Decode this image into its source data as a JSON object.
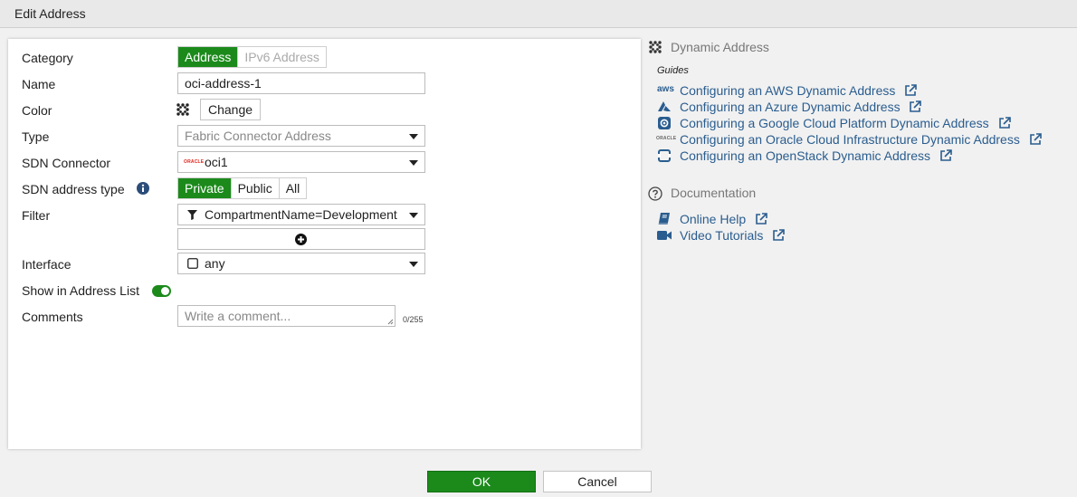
{
  "window": {
    "title": "Edit Address"
  },
  "form": {
    "category": {
      "label": "Category",
      "options": [
        "Address",
        "IPv6 Address"
      ],
      "selected": "Address"
    },
    "name": {
      "label": "Name",
      "value": "oci-address-1"
    },
    "color": {
      "label": "Color",
      "change_label": "Change"
    },
    "type": {
      "label": "Type",
      "value": "Fabric Connector Address"
    },
    "sdn_connector": {
      "label": "SDN Connector",
      "value": "oci1",
      "logo_text": "ORACLE"
    },
    "sdn_address_type": {
      "label": "SDN address type",
      "options": [
        "Private",
        "Public",
        "All"
      ],
      "selected": "Private"
    },
    "filter": {
      "label": "Filter",
      "value": "CompartmentName=Development"
    },
    "interface": {
      "label": "Interface",
      "value": "any"
    },
    "show_in_address_list": {
      "label": "Show in Address List",
      "enabled": true
    },
    "comments": {
      "label": "Comments",
      "placeholder": "Write a comment...",
      "counter": "0/255"
    }
  },
  "sidebar": {
    "dynamic_address": {
      "title": "Dynamic Address",
      "guides_label": "Guides",
      "links": [
        {
          "icon": "aws-icon",
          "label": "Configuring an AWS Dynamic Address"
        },
        {
          "icon": "azure-icon",
          "label": "Configuring an Azure Dynamic Address"
        },
        {
          "icon": "gcp-icon",
          "label": "Configuring a Google Cloud Platform Dynamic Address"
        },
        {
          "icon": "oracle-icon",
          "label": "Configuring an Oracle Cloud Infrastructure Dynamic Address"
        },
        {
          "icon": "openstack-icon",
          "label": "Configuring an OpenStack Dynamic Address"
        }
      ]
    },
    "documentation": {
      "title": "Documentation",
      "links": [
        {
          "icon": "book-icon",
          "label": "Online Help"
        },
        {
          "icon": "video-icon",
          "label": "Video Tutorials"
        }
      ]
    }
  },
  "footer": {
    "ok_label": "OK",
    "cancel_label": "Cancel"
  },
  "colors": {
    "accent": "#1b8a1b",
    "link": "#2a5d8f",
    "oracle": "#e2231a"
  },
  "aws_logo_text": "aws"
}
